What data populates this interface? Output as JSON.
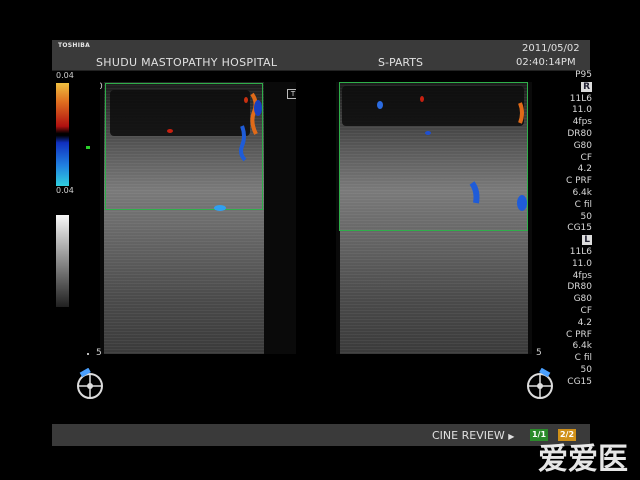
{
  "header": {
    "brand": "TOSHIBA",
    "hospital": "SHUDU MASTOPATHY HOSPITAL",
    "preset": "S-PARTS",
    "date": "2011/05/02",
    "time": "02:40:14PM"
  },
  "color_scale": {
    "top": "0.04",
    "bottom": "0.04",
    "positive_color": "#e07020",
    "negative_color": "#2080e0"
  },
  "left_image": {
    "depth_start": "0",
    "depth_end": "5",
    "marker": "T"
  },
  "right_image": {
    "depth_start": "0",
    "depth_end": "5"
  },
  "params": [
    {
      "text": "P95"
    },
    {
      "text": "R",
      "boxed": true
    },
    {
      "text": "11L6"
    },
    {
      "text": "11.0"
    },
    {
      "text": "4fps"
    },
    {
      "text": "DR80"
    },
    {
      "text": "G80"
    },
    {
      "text": "CF"
    },
    {
      "text": "4.2"
    },
    {
      "text": "C PRF"
    },
    {
      "text": "6.4k"
    },
    {
      "text": "C fil"
    },
    {
      "text": "50"
    },
    {
      "text": "CG15"
    },
    {
      "text": "L",
      "boxed": true
    },
    {
      "text": "11L6"
    },
    {
      "text": "11.0"
    },
    {
      "text": "4fps"
    },
    {
      "text": "DR80"
    },
    {
      "text": "G80"
    },
    {
      "text": "CF"
    },
    {
      "text": "4.2"
    },
    {
      "text": "C PRF"
    },
    {
      "text": "6.4k"
    },
    {
      "text": "C fil"
    },
    {
      "text": "50"
    },
    {
      "text": "CG15"
    }
  ],
  "footer": {
    "cine_label": "CINE REVIEW",
    "arrow": "▶",
    "btn1": "1/1",
    "btn2": "2/2"
  },
  "watermark": "爱爱医",
  "icons": [
    "body-mark-probe-icon",
    "focus-marker-icon"
  ]
}
